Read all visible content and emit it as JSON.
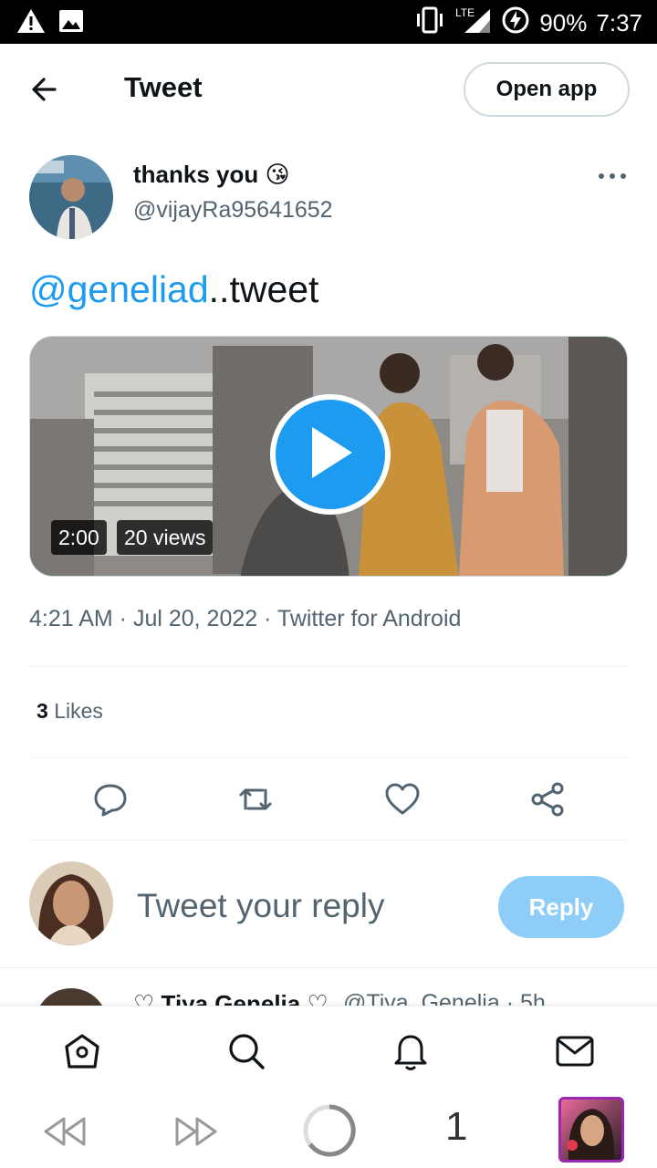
{
  "status_bar": {
    "battery": "90%",
    "time": "7:37",
    "network": "LTE"
  },
  "header": {
    "title": "Tweet",
    "open_app_label": "Open app"
  },
  "tweet": {
    "author_name": "thanks you",
    "author_emoji": "😘",
    "author_handle": "@vijayRa95641652",
    "mention": "@geneliad",
    "text_rest": "..tweet",
    "video_duration": "2:00",
    "video_views": "20 views",
    "timestamp": "4:21 AM · Jul 20, 2022 · Twitter for Android",
    "likes_count": "3",
    "likes_label": "Likes"
  },
  "composer": {
    "placeholder": "Tweet your reply",
    "reply_label": "Reply"
  },
  "next_tweet": {
    "name": "♡ Tiya Genelia ♡",
    "handle": "@Tiya_Genelia · 5h"
  },
  "browser": {
    "tab_count": "1"
  },
  "colors": {
    "accent": "#1d9bf0",
    "reply_disabled": "#8ecdf8",
    "secondary_text": "#536471"
  }
}
